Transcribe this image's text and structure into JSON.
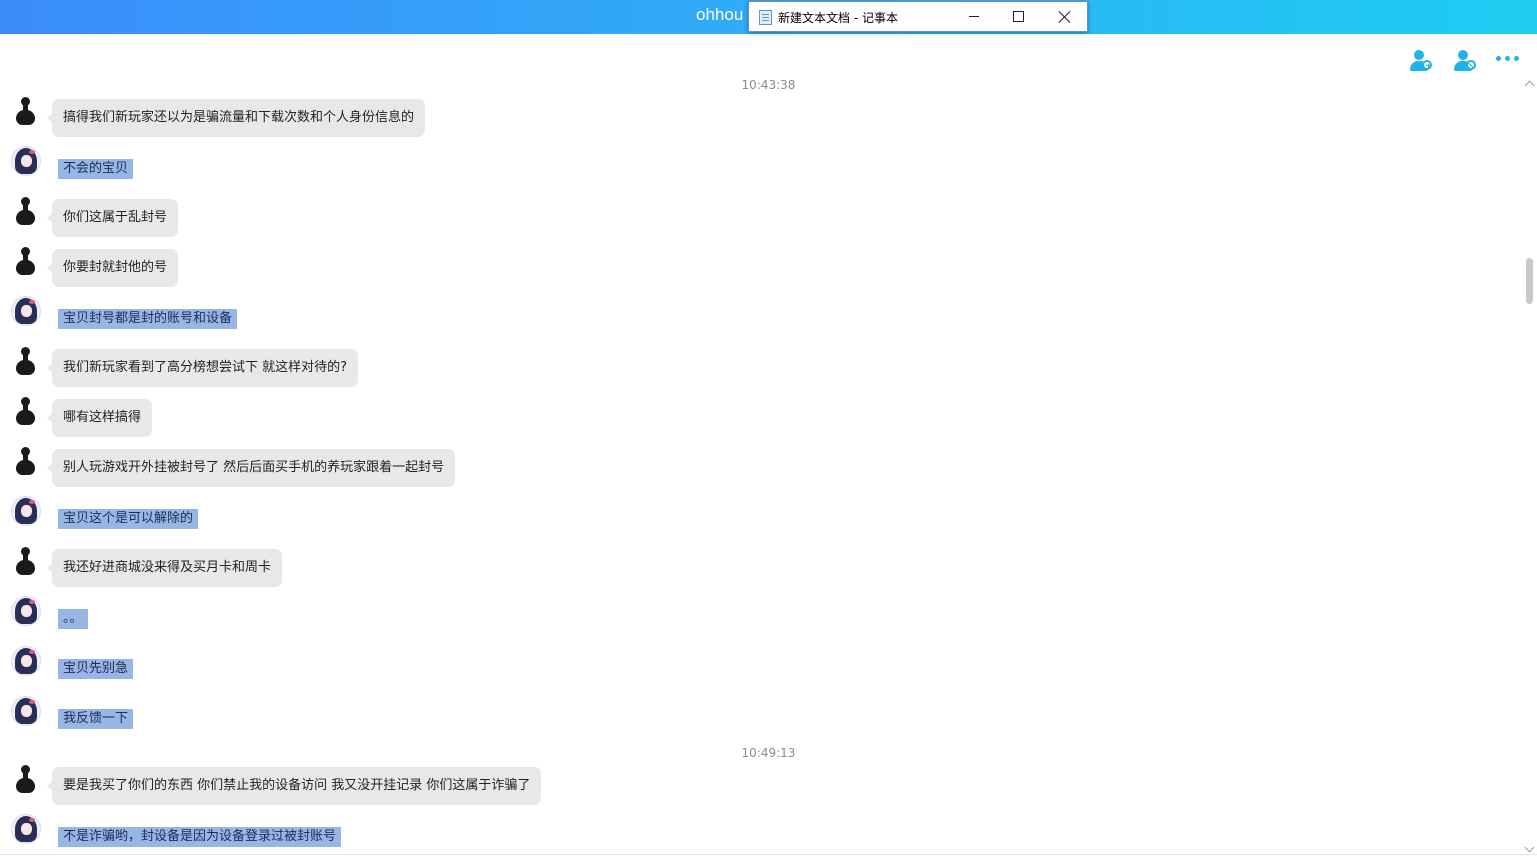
{
  "app": {
    "title": "ohhou"
  },
  "notepad": {
    "title": "新建文本文档 - 记事本"
  },
  "header": {
    "icons": [
      "add-user-icon",
      "block-user-icon",
      "more-icon"
    ]
  },
  "chat": {
    "times": [
      "10:43:38",
      "10:49:13"
    ],
    "messages": [
      {
        "from": "user",
        "text": "搞得我们新玩家还以为是骗流量和下载次数和个人身份信息的"
      },
      {
        "from": "agent",
        "text": "不会的宝贝"
      },
      {
        "from": "user",
        "text": "你们这属于乱封号"
      },
      {
        "from": "user",
        "text": "你要封就封他的号"
      },
      {
        "from": "agent",
        "text": "宝贝封号都是封的账号和设备"
      },
      {
        "from": "user",
        "text": "我们新玩家看到了高分榜想尝试下 就这样对待的?"
      },
      {
        "from": "user",
        "text": "哪有这样搞得"
      },
      {
        "from": "user",
        "text": "别人玩游戏开外挂被封号了 然后后面买手机的养玩家跟着一起封号"
      },
      {
        "from": "agent",
        "text": "宝贝这个是可以解除的"
      },
      {
        "from": "user",
        "text": "我还好进商城没来得及买月卡和周卡"
      },
      {
        "from": "agent",
        "text": "。。"
      },
      {
        "from": "agent",
        "text": "宝贝先别急"
      },
      {
        "from": "agent",
        "text": "我反馈一下"
      },
      {
        "from": "user",
        "text": "要是我买了你们的东西 你们禁止我的设备访问 我又没开挂记录 你们这属于诈骗了"
      },
      {
        "from": "agent",
        "text": "不是诈骗哟，封设备是因为设备登录过被封账号"
      }
    ]
  },
  "colors": {
    "accent": "#20b2e8",
    "user_bubble": "#e8e8e8",
    "agent_highlight": "#97b6e6"
  }
}
